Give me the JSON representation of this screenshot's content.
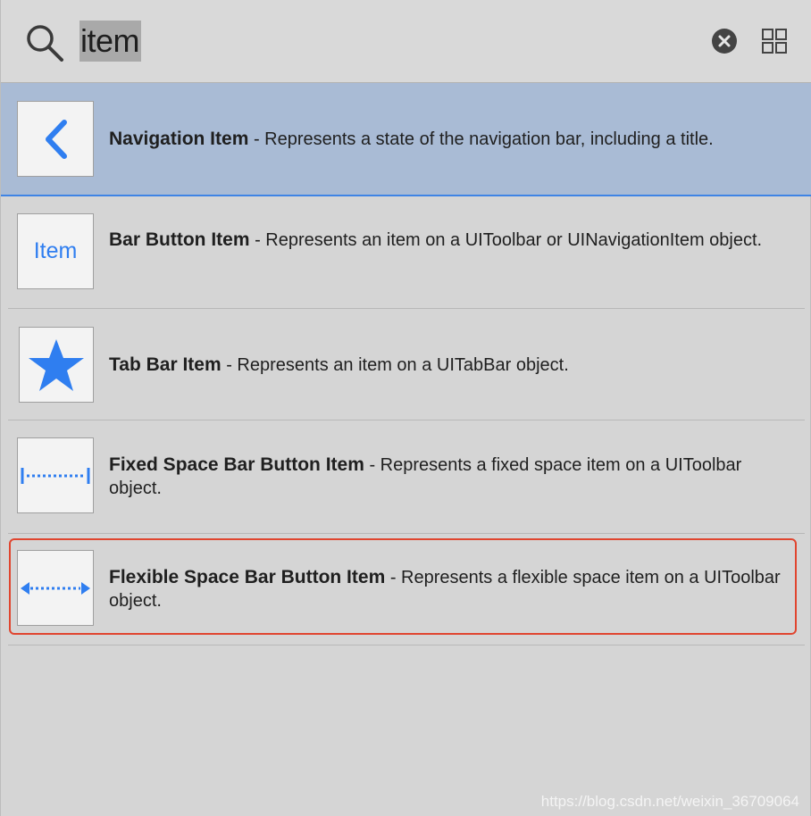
{
  "search": {
    "query": "item",
    "clear_icon": "clear-circle-x-icon",
    "view_toggle_icon": "grid-view-icon"
  },
  "items": [
    {
      "title": "Navigation Item",
      "description": "- Represents a state of the navigation bar, including a title.",
      "icon": "chevron-left-icon",
      "selected": true
    },
    {
      "title": "Bar Button Item",
      "description": "- Represents an item on a UIToolbar or UINavigationItem object.",
      "icon": "item-text-icon",
      "icon_label": "Item"
    },
    {
      "title": "Tab Bar Item",
      "description": "- Represents an item on a UITabBar object.",
      "icon": "star-icon"
    },
    {
      "title": "Fixed Space Bar Button Item",
      "description": "- Represents a fixed space item on a UIToolbar object.",
      "icon": "fixed-space-icon"
    },
    {
      "title": "Flexible Space Bar Button Item",
      "description": "- Represents a flexible space item on a UIToolbar object.",
      "icon": "flexible-space-icon",
      "highlighted": true
    }
  ],
  "watermark": "https://blog.csdn.net/weixin_36709064",
  "colors": {
    "accent": "#3f84e5",
    "selected_row": "#a9bbd5",
    "highlight_border": "#e0452f",
    "icon_blue": "#2f7ef0"
  }
}
